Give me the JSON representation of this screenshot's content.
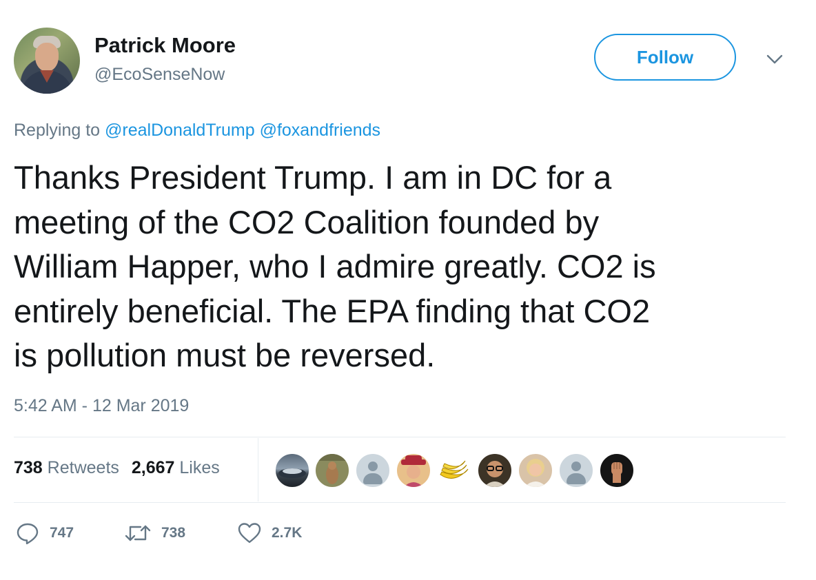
{
  "user": {
    "display_name": "Patrick Moore",
    "handle": "@EcoSenseNow"
  },
  "follow_button": {
    "label": "Follow"
  },
  "reply_context": {
    "prefix": "Replying to",
    "mentions": [
      "@realDonaldTrump",
      "@foxandfriends"
    ]
  },
  "tweet": {
    "lines": [
      "Thanks President Trump. I am in DC for a",
      "meeting of the CO2 Coalition founded by",
      "William Happer, who I admire greatly. CO2 is",
      "entirely beneficial. The EPA finding that CO2",
      "is pollution must be reversed."
    ],
    "timestamp": "5:42 AM - 12 Mar 2019"
  },
  "stats": {
    "retweets_count": "738",
    "retweets_label": "Retweets",
    "likes_count": "2,667",
    "likes_label": "Likes"
  },
  "likers": [
    {
      "icon": "car-photo-avatar"
    },
    {
      "icon": "kangaroo-meme-avatar"
    },
    {
      "icon": "default-avatar"
    },
    {
      "icon": "woman-hat-avatar"
    },
    {
      "icon": "bananas-avatar"
    },
    {
      "icon": "man-glasses-avatar"
    },
    {
      "icon": "woman-blonde-avatar"
    },
    {
      "icon": "default-avatar"
    },
    {
      "icon": "raised-fist-avatar"
    }
  ],
  "actions": {
    "replies": "747",
    "retweets": "738",
    "likes": "2.7K"
  },
  "colors": {
    "accent": "#1b95e0",
    "secondary_text": "#657786",
    "primary_text": "#14171a",
    "divider": "#e6ecf0"
  }
}
